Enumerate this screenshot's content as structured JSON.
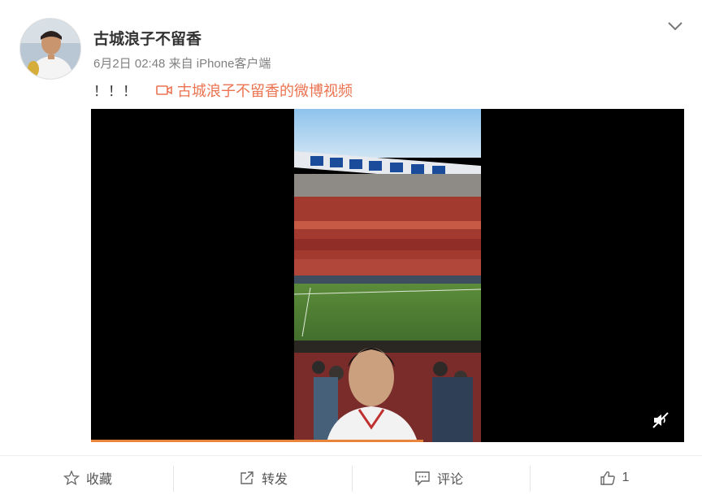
{
  "post": {
    "username": "古城浪子不留香",
    "timestamp": "6月2日 02:48",
    "source": "来自 iPhone客户端",
    "text": "！！！",
    "video_link_label": "古城浪子不留香的微博视频",
    "video_progress_percent": 56,
    "expand_icon": "chevron-down-icon",
    "mute_icon": "muted-speaker-icon"
  },
  "actions": [
    {
      "icon": "star-icon",
      "label": "收藏"
    },
    {
      "icon": "share-icon",
      "label": "转发"
    },
    {
      "icon": "comment-icon",
      "label": "评论"
    },
    {
      "icon": "thumb-up-icon",
      "label": "1"
    }
  ],
  "colors": {
    "link": "#eb7350",
    "progress": "#e8853a"
  }
}
